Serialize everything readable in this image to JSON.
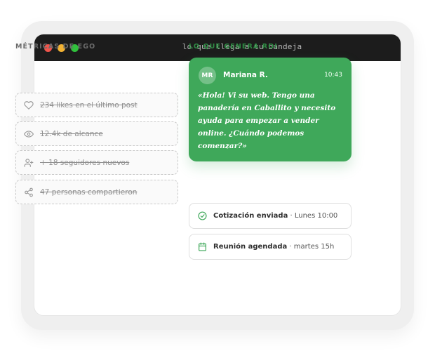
{
  "window": {
    "title": "lo que llega a tu bandeja"
  },
  "left_column": {
    "heading": "MÉTRICAS DE EGO",
    "items": [
      {
        "icon": "heart-icon",
        "label": "234 likes en el último post"
      },
      {
        "icon": "eye-icon",
        "label": "12.4k de alcance"
      },
      {
        "icon": "user-plus-icon",
        "label": "+ 18 seguidores nuevos"
      },
      {
        "icon": "share-icon",
        "label": "47 personas compartieron"
      }
    ]
  },
  "right_column": {
    "heading": "LO QUE GENERA ROI",
    "message": {
      "avatar_initials": "MR",
      "sender": "Mariana R.",
      "time": "10:43",
      "body": "«Hola! Vi su web. Tengo una panadería en Caballito y necesito ayuda para empezar a vender online. ¿Cuándo podemos comenzar?»"
    },
    "statuses": [
      {
        "icon": "check-circle-icon",
        "label": "Cotización enviada",
        "detail": " · Lunes 10:00"
      },
      {
        "icon": "calendar-icon",
        "label": "Reunión agendada",
        "detail": " · martes 15h"
      }
    ]
  },
  "colors": {
    "accent_green": "#3fa85a",
    "heading_green": "#2e8a43",
    "titlebar": "#1c1c1c"
  }
}
